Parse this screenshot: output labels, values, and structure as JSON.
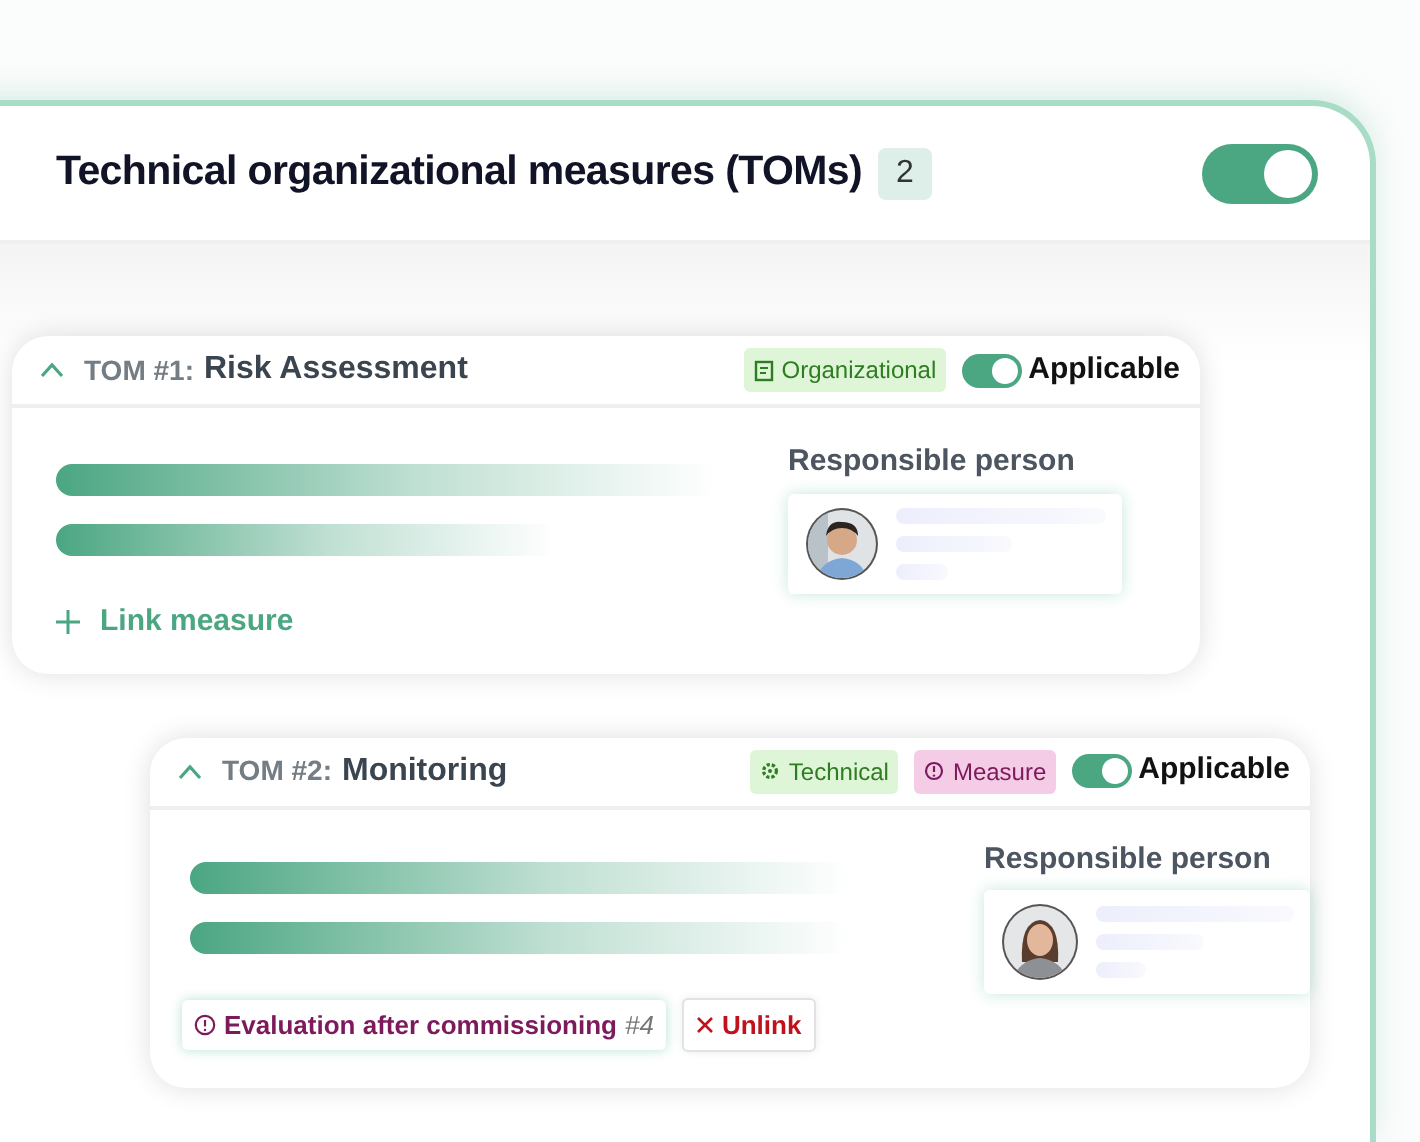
{
  "header": {
    "title": "Technical organizational measures (TOMs)",
    "count": "2",
    "toggle_on": true
  },
  "toms": [
    {
      "number": "TOM #1:",
      "name": "Risk Assessment",
      "expanded": true,
      "tags": [
        {
          "kind": "organizational",
          "label": "Organizational"
        }
      ],
      "applicable": true,
      "applicable_label": "Applicable",
      "responsible_label": "Responsible person",
      "avatar": {
        "kind": "picture"
      },
      "link_action": "Link measure"
    },
    {
      "number": "TOM #2:",
      "name": "Monitoring",
      "expanded": true,
      "tags": [
        {
          "kind": "technical",
          "label": "Technical"
        },
        {
          "kind": "measure",
          "label": "Measure"
        }
      ],
      "applicable": true,
      "applicable_label": "Applicable",
      "responsible_label": "Responsible person",
      "avatar": {
        "kind": "picture"
      },
      "linked": [
        {
          "label": "Evaluation after commissioning",
          "ref": "#4",
          "action": "Unlink"
        }
      ]
    }
  ]
}
